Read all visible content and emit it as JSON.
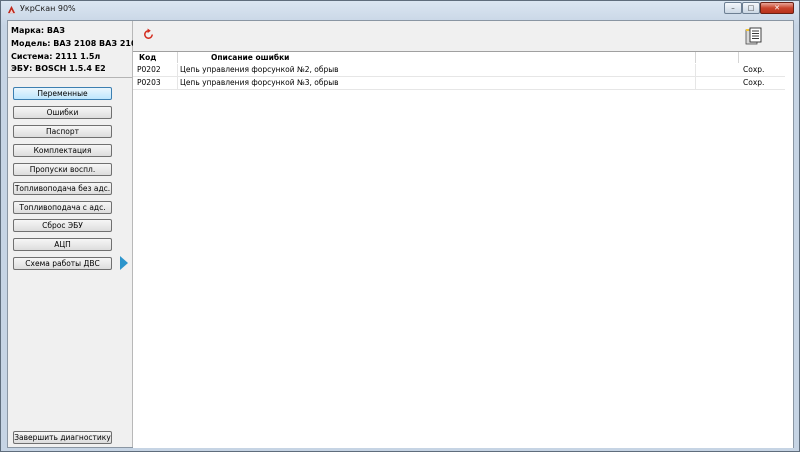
{
  "window": {
    "title": "УкрСкан 90%",
    "minimize": "–",
    "maximize": "□",
    "close": "✕"
  },
  "vehicle": {
    "brand": "Марка: ВАЗ",
    "model": "Модель: ВАЗ 2108 ВАЗ 210",
    "system": "Система: 2111 1.5л",
    "ecu": "ЭБУ: BOSCH 1.5.4 E2"
  },
  "nav": {
    "items": [
      {
        "label": "Переменные"
      },
      {
        "label": "Ошибки"
      },
      {
        "label": "Паспорт"
      },
      {
        "label": "Комплектация"
      },
      {
        "label": "Пропуски воспл."
      },
      {
        "label": "Топливоподача без адс."
      },
      {
        "label": "Топливоподача с адс."
      },
      {
        "label": "Сброс ЭБУ"
      },
      {
        "label": "АЦП"
      },
      {
        "label": "Схема работы ДВС"
      }
    ],
    "finish": "Завершить диагностику"
  },
  "toolbar": {
    "refresh_icon": "refresh-icon",
    "report_icon": "report-icon",
    "accent": "#d32a1c"
  },
  "table": {
    "headers": {
      "code": "Код",
      "description": "Описание ошибки"
    },
    "rows": [
      {
        "code": "P0202",
        "description": "Цепь управления форсункой  №2, обрыв",
        "action": "Сохр."
      },
      {
        "code": "P0203",
        "description": "Цепь управления форсункой  №3, обрыв",
        "action": "Сохр."
      }
    ]
  },
  "colors": {
    "active_button": "#bee6fd",
    "arrow": "#2d95cc"
  }
}
